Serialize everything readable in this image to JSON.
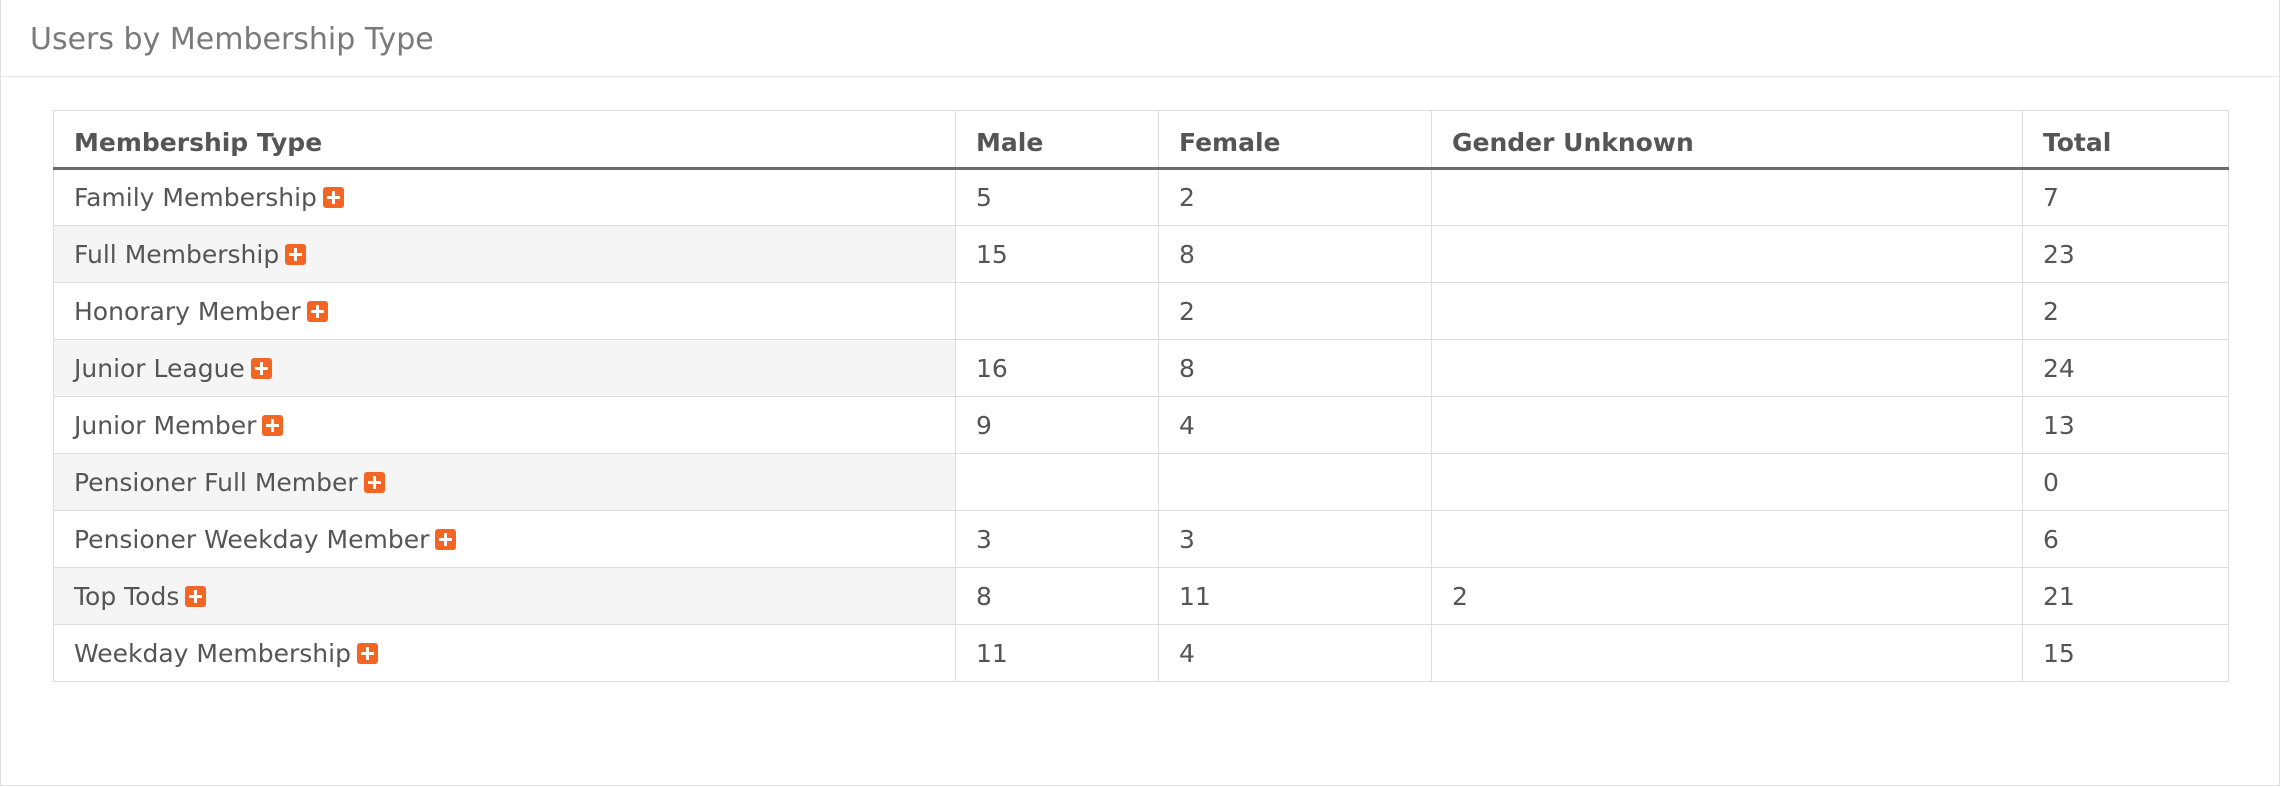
{
  "colors": {
    "accent": "#f26522",
    "icon": "#f26522"
  },
  "panel": {
    "title": "Users by Membership Type"
  },
  "table": {
    "headers": [
      "Membership Type",
      "Male",
      "Female",
      "Gender Unknown",
      "Total"
    ],
    "rows": [
      {
        "name": "Family Membership",
        "male": "5",
        "female": "2",
        "unknown": "",
        "total": "7"
      },
      {
        "name": "Full Membership",
        "male": "15",
        "female": "8",
        "unknown": "",
        "total": "23"
      },
      {
        "name": "Honorary Member",
        "male": "",
        "female": "2",
        "unknown": "",
        "total": "2"
      },
      {
        "name": "Junior League",
        "male": "16",
        "female": "8",
        "unknown": "",
        "total": "24"
      },
      {
        "name": "Junior Member",
        "male": "9",
        "female": "4",
        "unknown": "",
        "total": "13"
      },
      {
        "name": "Pensioner Full Member",
        "male": "",
        "female": "",
        "unknown": "",
        "total": "0"
      },
      {
        "name": "Pensioner Weekday Member",
        "male": "3",
        "female": "3",
        "unknown": "",
        "total": "6"
      },
      {
        "name": "Top Tods",
        "male": "8",
        "female": "11",
        "unknown": "2",
        "total": "21"
      },
      {
        "name": "Weekday Membership",
        "male": "11",
        "female": "4",
        "unknown": "",
        "total": "15"
      }
    ],
    "expand_icon": "plus-square-icon"
  }
}
